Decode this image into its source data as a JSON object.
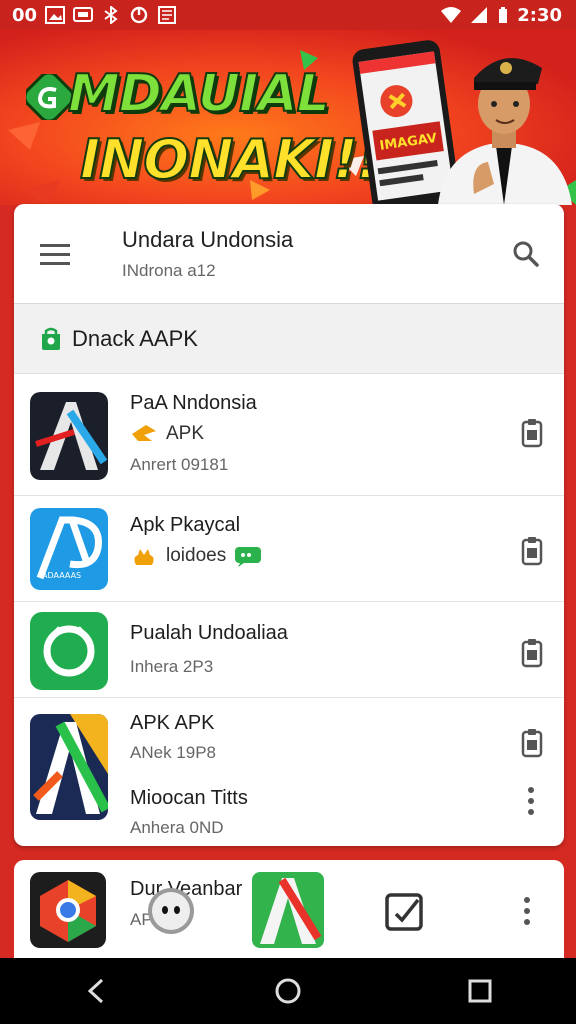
{
  "status_bar": {
    "left_text": "00",
    "time": "2:30",
    "icons": [
      "image-icon",
      "message-icon",
      "bluetooth-icon",
      "sync-icon",
      "app-icon",
      "wifi-icon",
      "signal-icon",
      "battery-icon"
    ]
  },
  "banner": {
    "headline_line1": "MDAUIAL",
    "headline_line2": "INONAKI!!",
    "phone_text": "IMAGAV"
  },
  "header": {
    "title": "Undara Undonsia",
    "subtitle": "INdrona a12"
  },
  "section": {
    "label": "Dnack AAPK"
  },
  "apps": [
    {
      "title": "PaA Nndonsia",
      "sub": "APK",
      "meta": "Anrert 09181",
      "icon": "app-a-dark-icon",
      "sub_icon": "arrow-badge-icon"
    },
    {
      "title": "Apk Pkaycal",
      "sub": "loidoes",
      "meta": "",
      "icon": "app-a-blue-icon",
      "sub_icon": "hand-icon"
    },
    {
      "title": "Pualah Undoaliaa",
      "sub": "",
      "meta": "Inhera 2P3",
      "icon": "app-green-circle-icon",
      "sub_icon": ""
    },
    {
      "title": "APK APK",
      "sub": "",
      "meta": "ANek 19P8",
      "extra_title": "Mioocan Titts",
      "extra_meta": "Anhera 0ND",
      "icon": "app-a-multicolor-icon",
      "sub_icon": ""
    }
  ],
  "bottom_card": {
    "title": "Dur Veanbar",
    "sub": "AP 3"
  },
  "colors": {
    "background_red": "#d42a22",
    "accent_green": "#1fa64a",
    "headline_green": "#7ee03a",
    "headline_yellow": "#ffe02a"
  }
}
